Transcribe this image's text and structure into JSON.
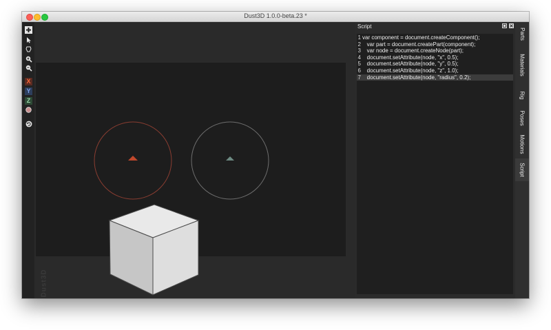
{
  "window": {
    "title": "Dust3D 1.0.0-beta.23 *"
  },
  "toolbar": {
    "icons": [
      "add-icon",
      "select-icon",
      "paint-icon",
      "zoom-in-icon",
      "zoom-out-icon",
      "rotate-icon"
    ],
    "axes": {
      "x": "X",
      "y": "Y",
      "z": "Z"
    }
  },
  "viewport": {
    "watermark": "Dust3D",
    "nodes": [
      {
        "color": "#c0482c",
        "ring_color": "#8a3d31"
      },
      {
        "color": "#6d8a82",
        "ring_color": "#6e6e6e"
      }
    ]
  },
  "script_panel": {
    "title": "Script",
    "current_line": 7,
    "lines": [
      {
        "num": "1",
        "code": "var component = document.createComponent();"
      },
      {
        "num": "2",
        "code": "   var part = document.createPart(component);"
      },
      {
        "num": "3",
        "code": "   var node = document.createNode(part);"
      },
      {
        "num": "4",
        "code": "   document.setAttribute(node, \"x\", 0.5);"
      },
      {
        "num": "5",
        "code": "   document.setAttribute(node, \"y\", 0.5);"
      },
      {
        "num": "6",
        "code": "   document.setAttribute(node, \"z\", 1.0);"
      },
      {
        "num": "7",
        "code": "   document.setAttribute(node, \"radius\", 0.2);"
      }
    ]
  },
  "side_tabs": [
    {
      "label": "Parts"
    },
    {
      "label": "Materials"
    },
    {
      "label": "Rig"
    },
    {
      "label": "Poses"
    },
    {
      "label": "Motions"
    },
    {
      "label": "Script"
    }
  ],
  "active_tab": "Script"
}
